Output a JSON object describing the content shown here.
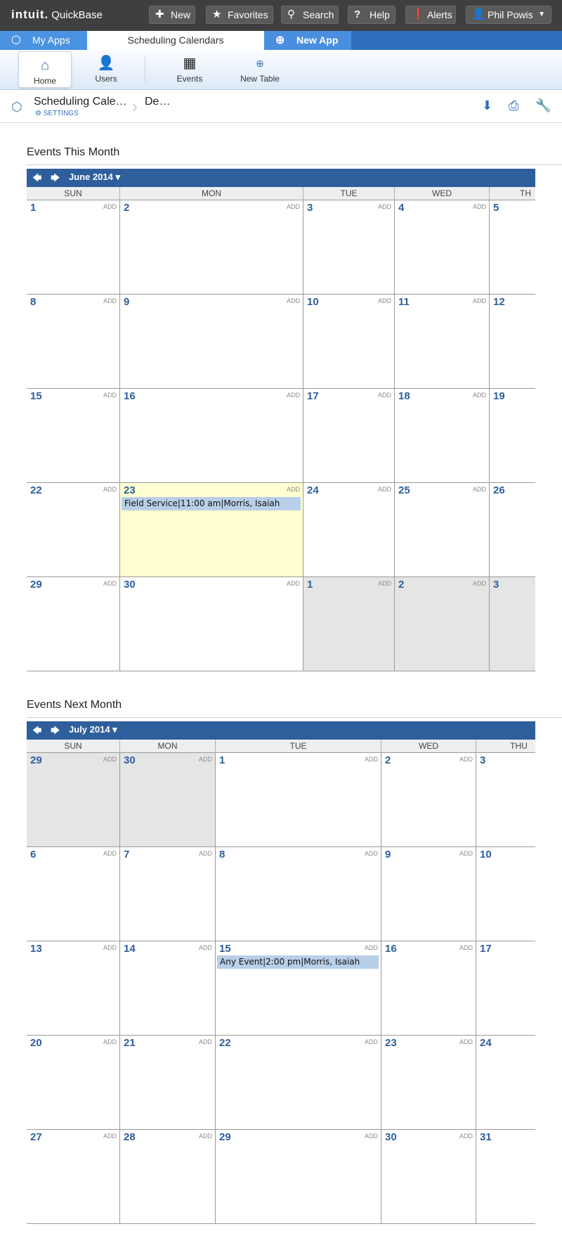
{
  "topbar": {
    "brand_intuit": "intuit.",
    "brand_product": "QuickBase",
    "buttons": {
      "new": "New",
      "favorites": "Favorites",
      "search": "Search",
      "help": "Help",
      "alerts": "Alerts",
      "user": "Phil Powis"
    }
  },
  "tabs": {
    "myapps": "My Apps",
    "current": "Scheduling Calendars",
    "newapp": "New App"
  },
  "toolbar": {
    "home": "Home",
    "users": "Users",
    "events": "Events",
    "new_table": "New Table"
  },
  "breadcrumb": {
    "app": "Scheduling Cale…",
    "settings": "SETTINGS",
    "page": "De…"
  },
  "this_month": {
    "section_title": "Events This Month",
    "month_label": "June 2014 ▾",
    "add_label": "ADD",
    "day_headers": [
      "SUN",
      "MON",
      "TUE",
      "WED",
      "TH"
    ],
    "weeks": [
      [
        {
          "d": "1"
        },
        {
          "d": "2"
        },
        {
          "d": "3"
        },
        {
          "d": "4"
        },
        {
          "d": "5"
        }
      ],
      [
        {
          "d": "8"
        },
        {
          "d": "9"
        },
        {
          "d": "10"
        },
        {
          "d": "11"
        },
        {
          "d": "12"
        }
      ],
      [
        {
          "d": "15"
        },
        {
          "d": "16"
        },
        {
          "d": "17"
        },
        {
          "d": "18"
        },
        {
          "d": "19"
        }
      ],
      [
        {
          "d": "22"
        },
        {
          "d": "23",
          "today": true,
          "event": "Field Service|11:00 am|Morris, Isaiah"
        },
        {
          "d": "24"
        },
        {
          "d": "25"
        },
        {
          "d": "26"
        }
      ],
      [
        {
          "d": "29"
        },
        {
          "d": "30"
        },
        {
          "d": "1",
          "other": true
        },
        {
          "d": "2",
          "other": true
        },
        {
          "d": "3",
          "other": true
        }
      ]
    ]
  },
  "next_month": {
    "section_title": "Events Next Month",
    "month_label": "July 2014 ▾",
    "add_label": "ADD",
    "day_headers": [
      "SUN",
      "MON",
      "TUE",
      "WED",
      "THU"
    ],
    "weeks": [
      [
        {
          "d": "29",
          "other": true
        },
        {
          "d": "30",
          "other": true
        },
        {
          "d": "1"
        },
        {
          "d": "2"
        },
        {
          "d": "3"
        }
      ],
      [
        {
          "d": "6"
        },
        {
          "d": "7"
        },
        {
          "d": "8"
        },
        {
          "d": "9"
        },
        {
          "d": "10"
        }
      ],
      [
        {
          "d": "13"
        },
        {
          "d": "14"
        },
        {
          "d": "15",
          "event": "Any Event|2:00 pm|Morris, Isaiah"
        },
        {
          "d": "16"
        },
        {
          "d": "17"
        }
      ],
      [
        {
          "d": "20"
        },
        {
          "d": "21"
        },
        {
          "d": "22"
        },
        {
          "d": "23"
        },
        {
          "d": "24"
        }
      ],
      [
        {
          "d": "27"
        },
        {
          "d": "28"
        },
        {
          "d": "29"
        },
        {
          "d": "30"
        },
        {
          "d": "31"
        }
      ]
    ]
  }
}
